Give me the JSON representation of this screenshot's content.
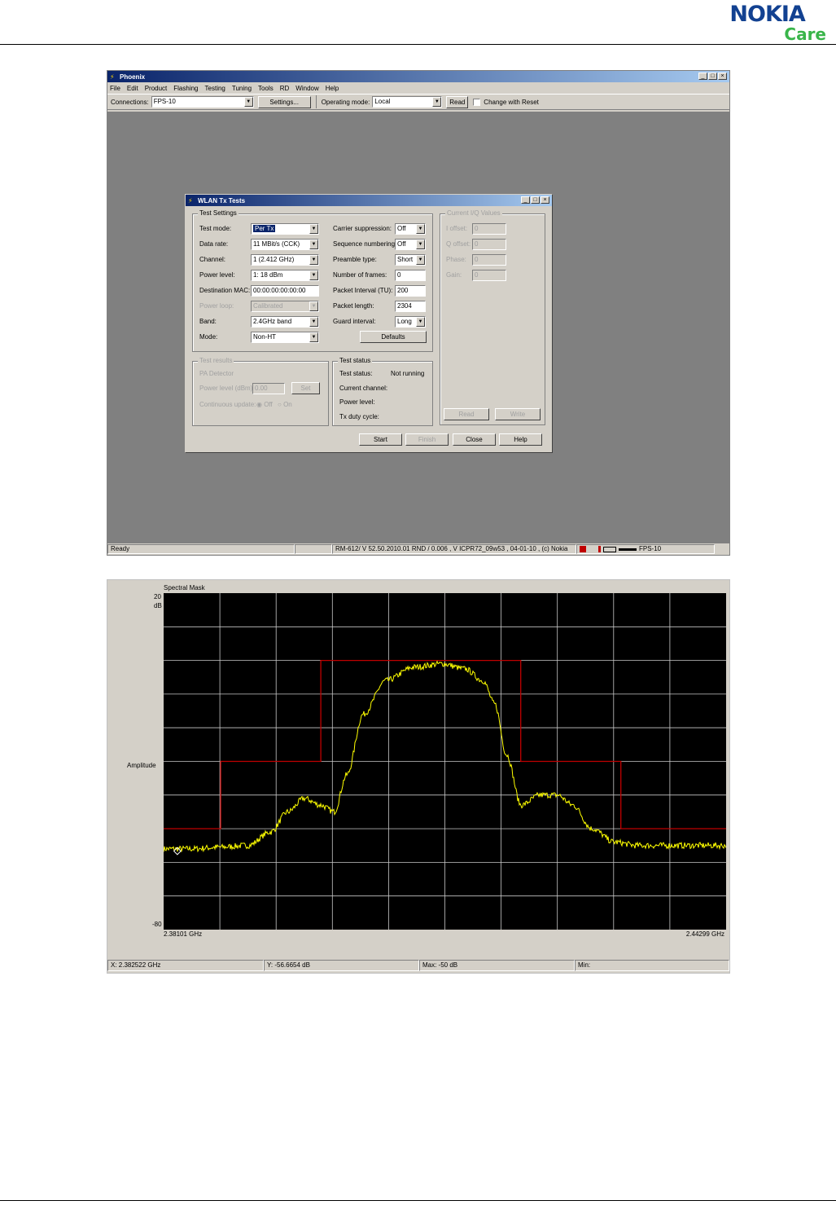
{
  "brand": {
    "nokia": "NOKIA",
    "care": "Care"
  },
  "phoenix": {
    "title": "Phoenix",
    "menu": [
      "File",
      "Edit",
      "Product",
      "Flashing",
      "Testing",
      "Tuning",
      "Tools",
      "RD",
      "Window",
      "Help"
    ],
    "toolbar": {
      "connections_label": "Connections:",
      "connections_value": "FPS-10",
      "settings_btn": "Settings...",
      "opmode_label": "Operating mode:",
      "opmode_value": "Local",
      "read_btn": "Read",
      "change_with_reset": "Change with Reset"
    },
    "status": {
      "ready": "Ready",
      "version": "RM-612/ V 52.50.2010.01 RND / 0.006 , V ICPR72_09w53 , 04-01-10 , (c) Nokia",
      "connection": "FPS-10"
    }
  },
  "dialog": {
    "title": "WLAN Tx Tests",
    "test_settings": {
      "legend": "Test Settings",
      "test_mode": {
        "label": "Test mode:",
        "value": "Per Tx"
      },
      "data_rate": {
        "label": "Data rate:",
        "value": "11 MBit/s (CCK)"
      },
      "channel": {
        "label": "Channel:",
        "value": "1  (2.412 GHz)"
      },
      "power_level": {
        "label": "Power level:",
        "value": "1:  18 dBm"
      },
      "dest_mac": {
        "label": "Destination MAC:",
        "value": "00:00:00:00:00:00"
      },
      "power_loop": {
        "label": "Power loop:",
        "value": "Calibrated"
      },
      "band": {
        "label": "Band:",
        "value": "2.4GHz band"
      },
      "mode": {
        "label": "Mode:",
        "value": "Non-HT"
      },
      "carrier_suppression": {
        "label": "Carrier suppression:",
        "value": "Off"
      },
      "sequence_numbering": {
        "label": "Sequence numbering:",
        "value": "Off"
      },
      "preamble_type": {
        "label": "Preamble type:",
        "value": "Short"
      },
      "number_of_frames": {
        "label": "Number of frames:",
        "value": "0"
      },
      "packet_interval": {
        "label": "Packet Interval (TU):",
        "value": "200"
      },
      "packet_length": {
        "label": "Packet length:",
        "value": "2304"
      },
      "guard_interval": {
        "label": "Guard interval:",
        "value": "Long"
      },
      "defaults_btn": "Defaults"
    },
    "iq": {
      "legend": "Current I/Q Values",
      "i_offset": {
        "label": "I offset:",
        "value": "0"
      },
      "q_offset": {
        "label": "Q offset:",
        "value": "0"
      },
      "phase": {
        "label": "Phase:",
        "value": "0"
      },
      "gain": {
        "label": "Gain:",
        "value": "0"
      },
      "read_btn": "Read",
      "write_btn": "Write"
    },
    "test_results": {
      "legend": "Test results",
      "pa_detector": "PA Detector",
      "power_level_label": "Power level (dBm):",
      "power_level_value": "0.00",
      "set_btn": "Set",
      "continuous_label": "Continuous update:",
      "off": "Off",
      "on": "On"
    },
    "test_status": {
      "legend": "Test status",
      "status_label": "Test status:",
      "status_value": "Not running",
      "current_channel": "Current channel:",
      "power_level": "Power level:",
      "duty_cycle": "Tx duty cycle:"
    },
    "buttons": {
      "start": "Start",
      "finish": "Finish",
      "close": "Close",
      "help": "Help"
    }
  },
  "spectrum": {
    "title": "Spectral Mask",
    "y_top": "20",
    "y_unit": "dB",
    "y_axis": "Amplitude",
    "y_bottom": "-80",
    "x_left": "2.38101 GHz",
    "x_right": "2.44299 GHz",
    "readout": {
      "x": "X: 2.382522 GHz",
      "y": "Y: -56.6654 dB",
      "max": "Max: -50 dB",
      "min": "Min:"
    }
  },
  "chart_data": {
    "type": "line",
    "title": "Spectral Mask",
    "xlabel": "",
    "ylabel": "Amplitude",
    "xlim": [
      2.38101,
      2.44299
    ],
    "ylim": [
      -80,
      20
    ],
    "grid": true,
    "colors": {
      "mask": "#c00000",
      "signal": "#ffff00",
      "background": "#000000"
    },
    "series": [
      {
        "x": [
          2.38101,
          2.3873,
          2.3873,
          2.39833,
          2.39833,
          2.42036,
          2.42036,
          2.43139,
          2.43139,
          2.44299
        ],
        "y": [
          -50,
          -50,
          -30,
          -30,
          0,
          0,
          -30,
          -30,
          -50,
          -50
        ]
      },
      {
        "x": [
          2.38101,
          2.3841,
          2.3872,
          2.3903,
          2.3928,
          2.3947,
          2.3965,
          2.3983,
          2.3998,
          2.4012,
          2.403,
          2.4055,
          2.4086,
          2.4117,
          2.4142,
          2.4162,
          2.4175,
          2.4188,
          2.4204,
          2.4225,
          2.4244,
          2.4261,
          2.4282,
          2.4307,
          2.4332,
          2.4363,
          2.4401,
          2.44299
        ],
        "y": [
          -56,
          -56,
          -55.5,
          -55,
          -51,
          -45,
          -41,
          -43,
          -45,
          -34,
          -16,
          -6,
          -2,
          -1,
          -2.5,
          -6,
          -13,
          -28,
          -43,
          -40,
          -40,
          -43,
          -50,
          -54,
          -55,
          -55,
          -55,
          -55
        ]
      }
    ]
  }
}
